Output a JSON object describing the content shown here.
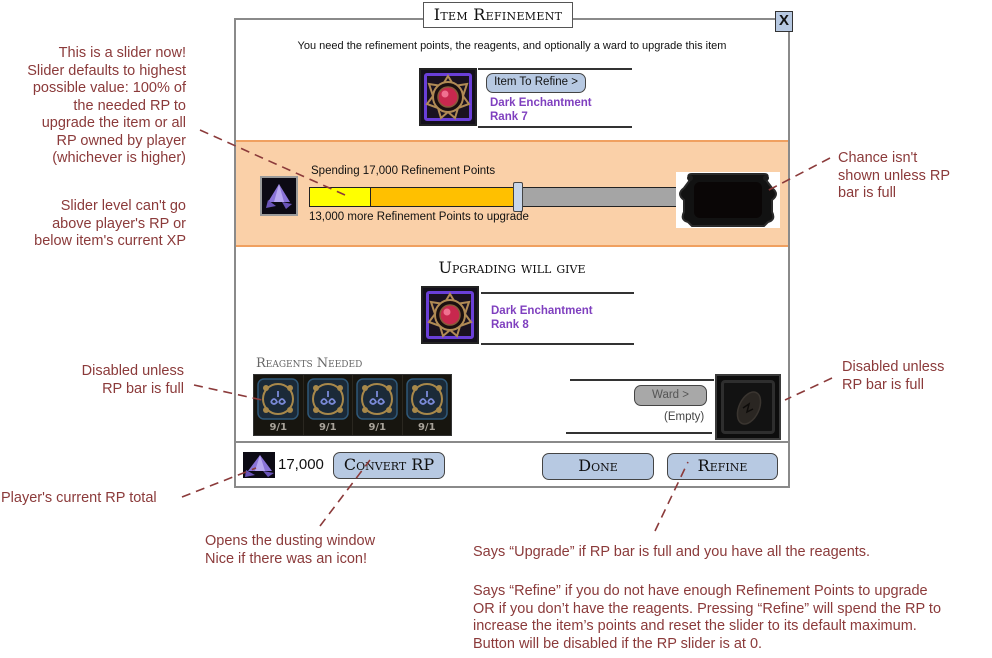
{
  "dialog": {
    "title": "Item Refinement",
    "close_label": "X",
    "intro": "You need the refinement points, the reagents, and optionally a ward to upgrade this item"
  },
  "item_to_refine": {
    "button_label": "Item To Refine >",
    "name": "Dark Enchantment",
    "rank": "Rank 7",
    "icon": "dark-enchantment-icon"
  },
  "slider": {
    "spending_text": "Spending 17,000 Refinement Points",
    "remaining_text": "13,000 more Refinement Points to upgrade",
    "current_fraction": 0.165,
    "spend_fraction": 0.565,
    "rp_icon": "refinement-points-icon",
    "chance_icon": "chance-frame-icon",
    "colors": {
      "current": "#ffff00",
      "spend": "#ffc000",
      "empty": "#a5a5a5",
      "band": "#fad0a8"
    }
  },
  "upgrade": {
    "heading": "Upgrading will give",
    "name": "Dark Enchantment",
    "rank": "Rank 8"
  },
  "reagents": {
    "heading": "Reagents Needed",
    "items": [
      {
        "count": "9/1"
      },
      {
        "count": "9/1"
      },
      {
        "count": "9/1"
      },
      {
        "count": "9/1"
      }
    ]
  },
  "ward": {
    "button_label": "Ward >",
    "status": "(Empty)"
  },
  "footer": {
    "rp_total": "17,000",
    "convert_label": "Convert RP",
    "done_label": "Done",
    "refine_label": "Refine"
  },
  "annotations": {
    "slider_note": [
      "This is a slider now!",
      "Slider defaults to highest",
      "possible value: 100% of",
      "the needed RP to",
      "upgrade the item or all",
      "RP owned by player",
      "(whichever is higher)"
    ],
    "slider_limit_note": [
      "Slider level can't go",
      "above player's RP or",
      "below item's current XP"
    ],
    "chance_note": [
      "Chance isn't",
      "shown unless RP",
      "bar is full"
    ],
    "reagents_note": [
      "Disabled unless",
      "RP bar is full"
    ],
    "ward_note": [
      "Disabled unless",
      "RP bar is full"
    ],
    "rp_total_note": "Player's current RP total",
    "convert_note": [
      "Opens the dusting window",
      "Nice if there was an icon!"
    ],
    "refine_note_1": "Says “Upgrade” if RP bar is full and you have all the reagents.",
    "refine_note_2": [
      "Says “Refine” if you do not have enough Refinement Points to upgrade",
      "OR if you don’t have the reagents. Pressing “Refine” will spend the RP to",
      "increase the item’s points and reset the slider to its default maximum.",
      "Button will be disabled if the RP slider is at 0."
    ]
  }
}
